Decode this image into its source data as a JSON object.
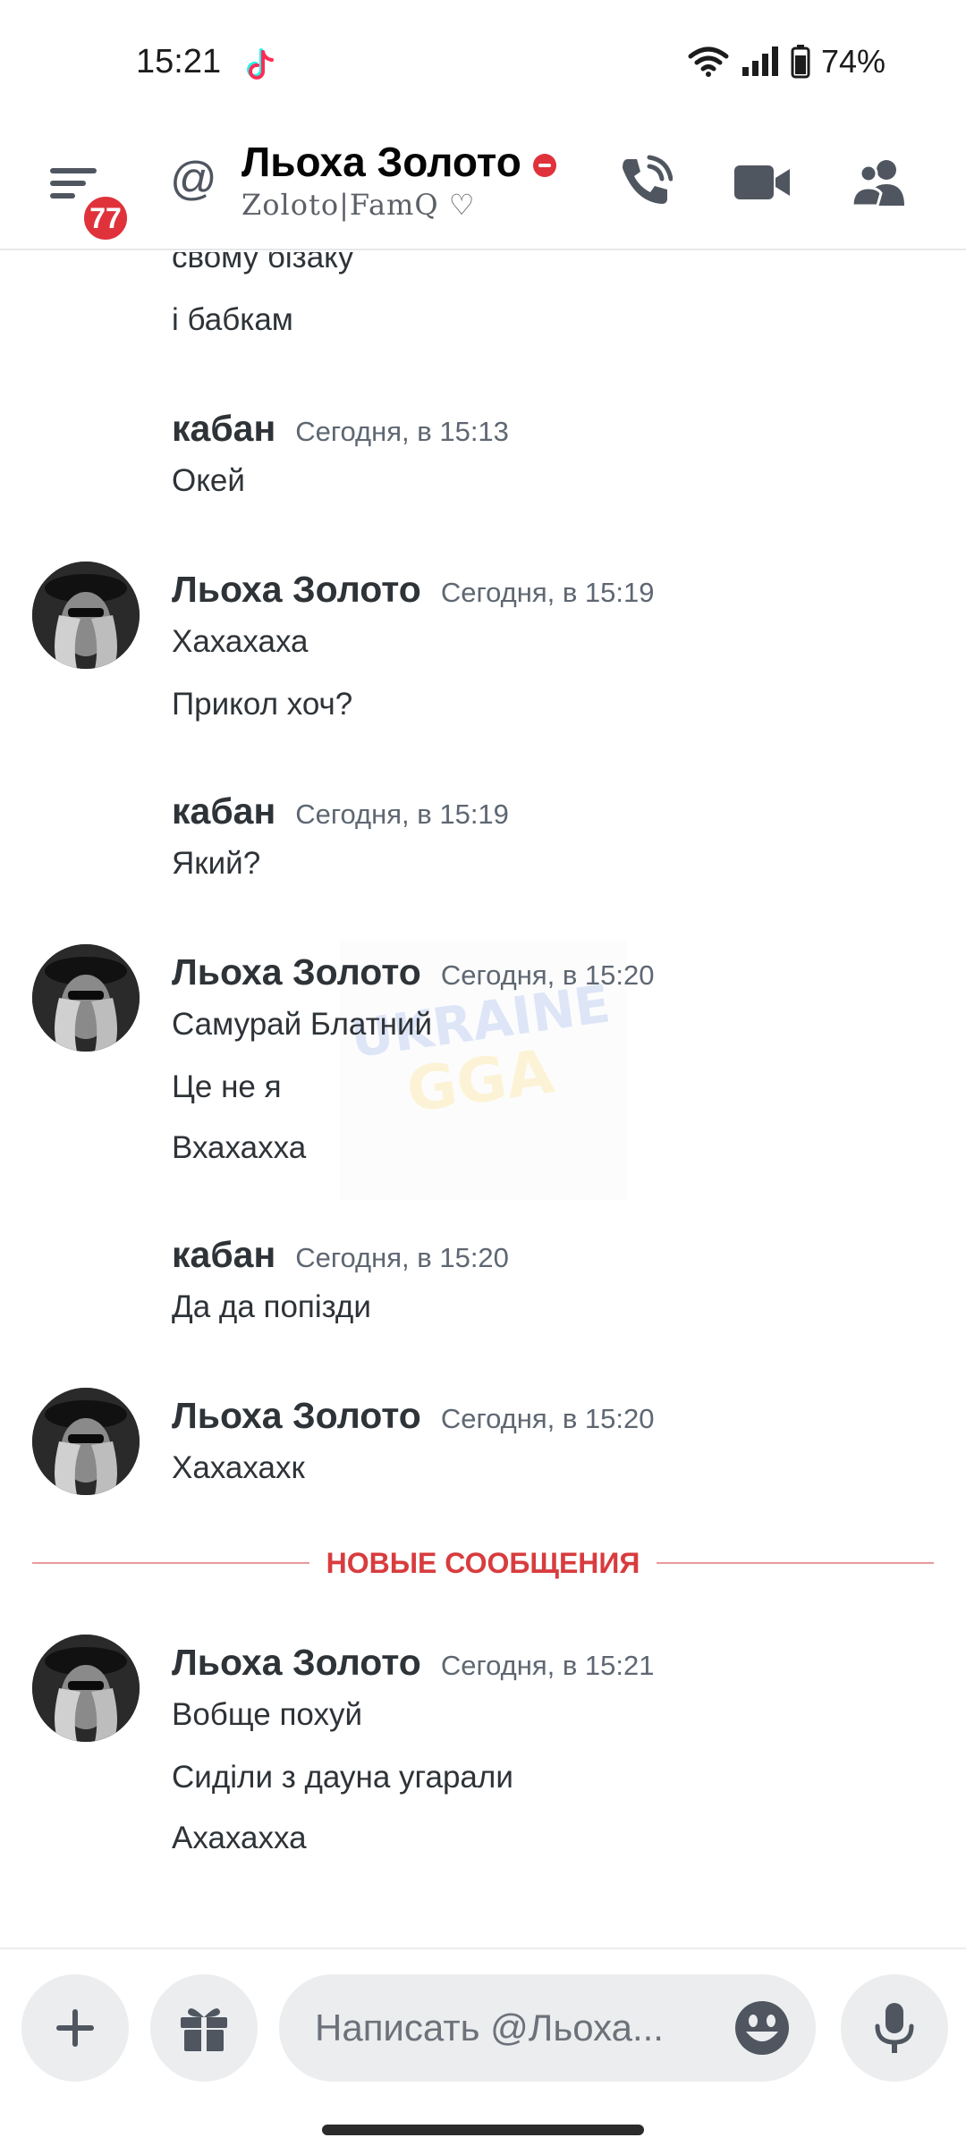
{
  "status_bar": {
    "time": "15:21",
    "battery": "74%"
  },
  "header": {
    "unread_badge": "77",
    "at_symbol": "@",
    "name": "Льоха Золото",
    "status_text": "Zoloto|FamQ ♡"
  },
  "messages": {
    "cut_off_line": "свому бізаку",
    "line_top": "і бабкам",
    "groups": [
      {
        "author": "кабан",
        "time": "Сегодня, в 15:13",
        "lines": [
          "Окей"
        ]
      },
      {
        "author": "Льоха Золото",
        "time": "Сегодня, в 15:19",
        "lines": [
          "Хахахаха",
          "Прикол хоч?"
        ]
      },
      {
        "author": "кабан",
        "time": "Сегодня, в 15:19",
        "lines": [
          "Який?"
        ]
      },
      {
        "author": "Льоха Золото",
        "time": "Сегодня, в 15:20",
        "lines": [
          "Самурай Блатний",
          "Це не я",
          "Вхахахха"
        ]
      },
      {
        "author": "кабан",
        "time": "Сегодня, в 15:20",
        "lines": [
          "Да да попізди"
        ]
      },
      {
        "author": "Льоха Золото",
        "time": "Сегодня, в 15:20",
        "lines": [
          "Хахахахк"
        ]
      },
      {
        "author": "Льоха Золото",
        "time": "Сегодня, в 15:21",
        "lines": [
          "Вобще похуй",
          "Сиділи з дауна угарали",
          "Ахахахха"
        ]
      }
    ],
    "new_messages_label": "НОВЫЕ СООБЩЕНИЯ"
  },
  "composer": {
    "placeholder": "Написать @Льоха..."
  },
  "colors": {
    "accent_red": "#e0323b",
    "divider_red": "#d83c3e",
    "text": "#2e3338",
    "muted": "#5e6772"
  }
}
